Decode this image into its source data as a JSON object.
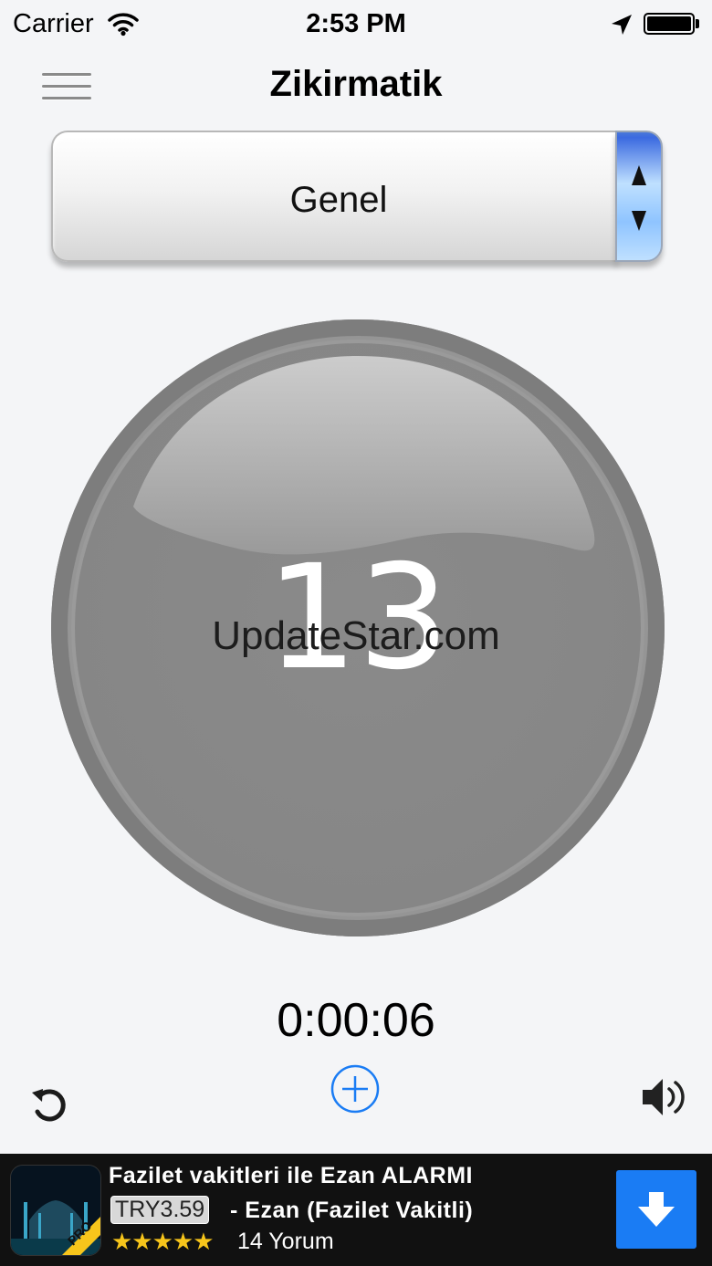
{
  "status_bar": {
    "carrier": "Carrier",
    "time": "2:53 PM",
    "icons": [
      "wifi-icon",
      "location-arrow-icon",
      "battery-icon"
    ]
  },
  "nav": {
    "title": "Zikirmatik",
    "menu_icon": "hamburger-menu-icon"
  },
  "picker": {
    "selected": "Genel",
    "arrows_icon": "up-down-arrows-icon"
  },
  "counter": {
    "count": "13"
  },
  "watermark": "UpdateStar.com",
  "timer": "0:00:06",
  "controls": {
    "reset_icon": "reset-icon",
    "add_icon": "plus-circle-icon",
    "sound_icon": "speaker-icon"
  },
  "ad": {
    "title": "Fazilet vakitleri ile Ezan ALARMI",
    "price": "TRY3.59",
    "name": "- Ezan (Fazilet Vakitli)",
    "stars": "★★★★★",
    "rating": 5,
    "reviews": "14 Yorum",
    "icon_badge": "PRO",
    "download_icon": "download-arrow-icon",
    "colors": {
      "background": "#111111",
      "download": "#1a7cf4",
      "stars": "#f7c51b"
    }
  },
  "colors": {
    "background": "#f4f5f7",
    "accent": "#1a7cf4",
    "counter": "#868686"
  }
}
